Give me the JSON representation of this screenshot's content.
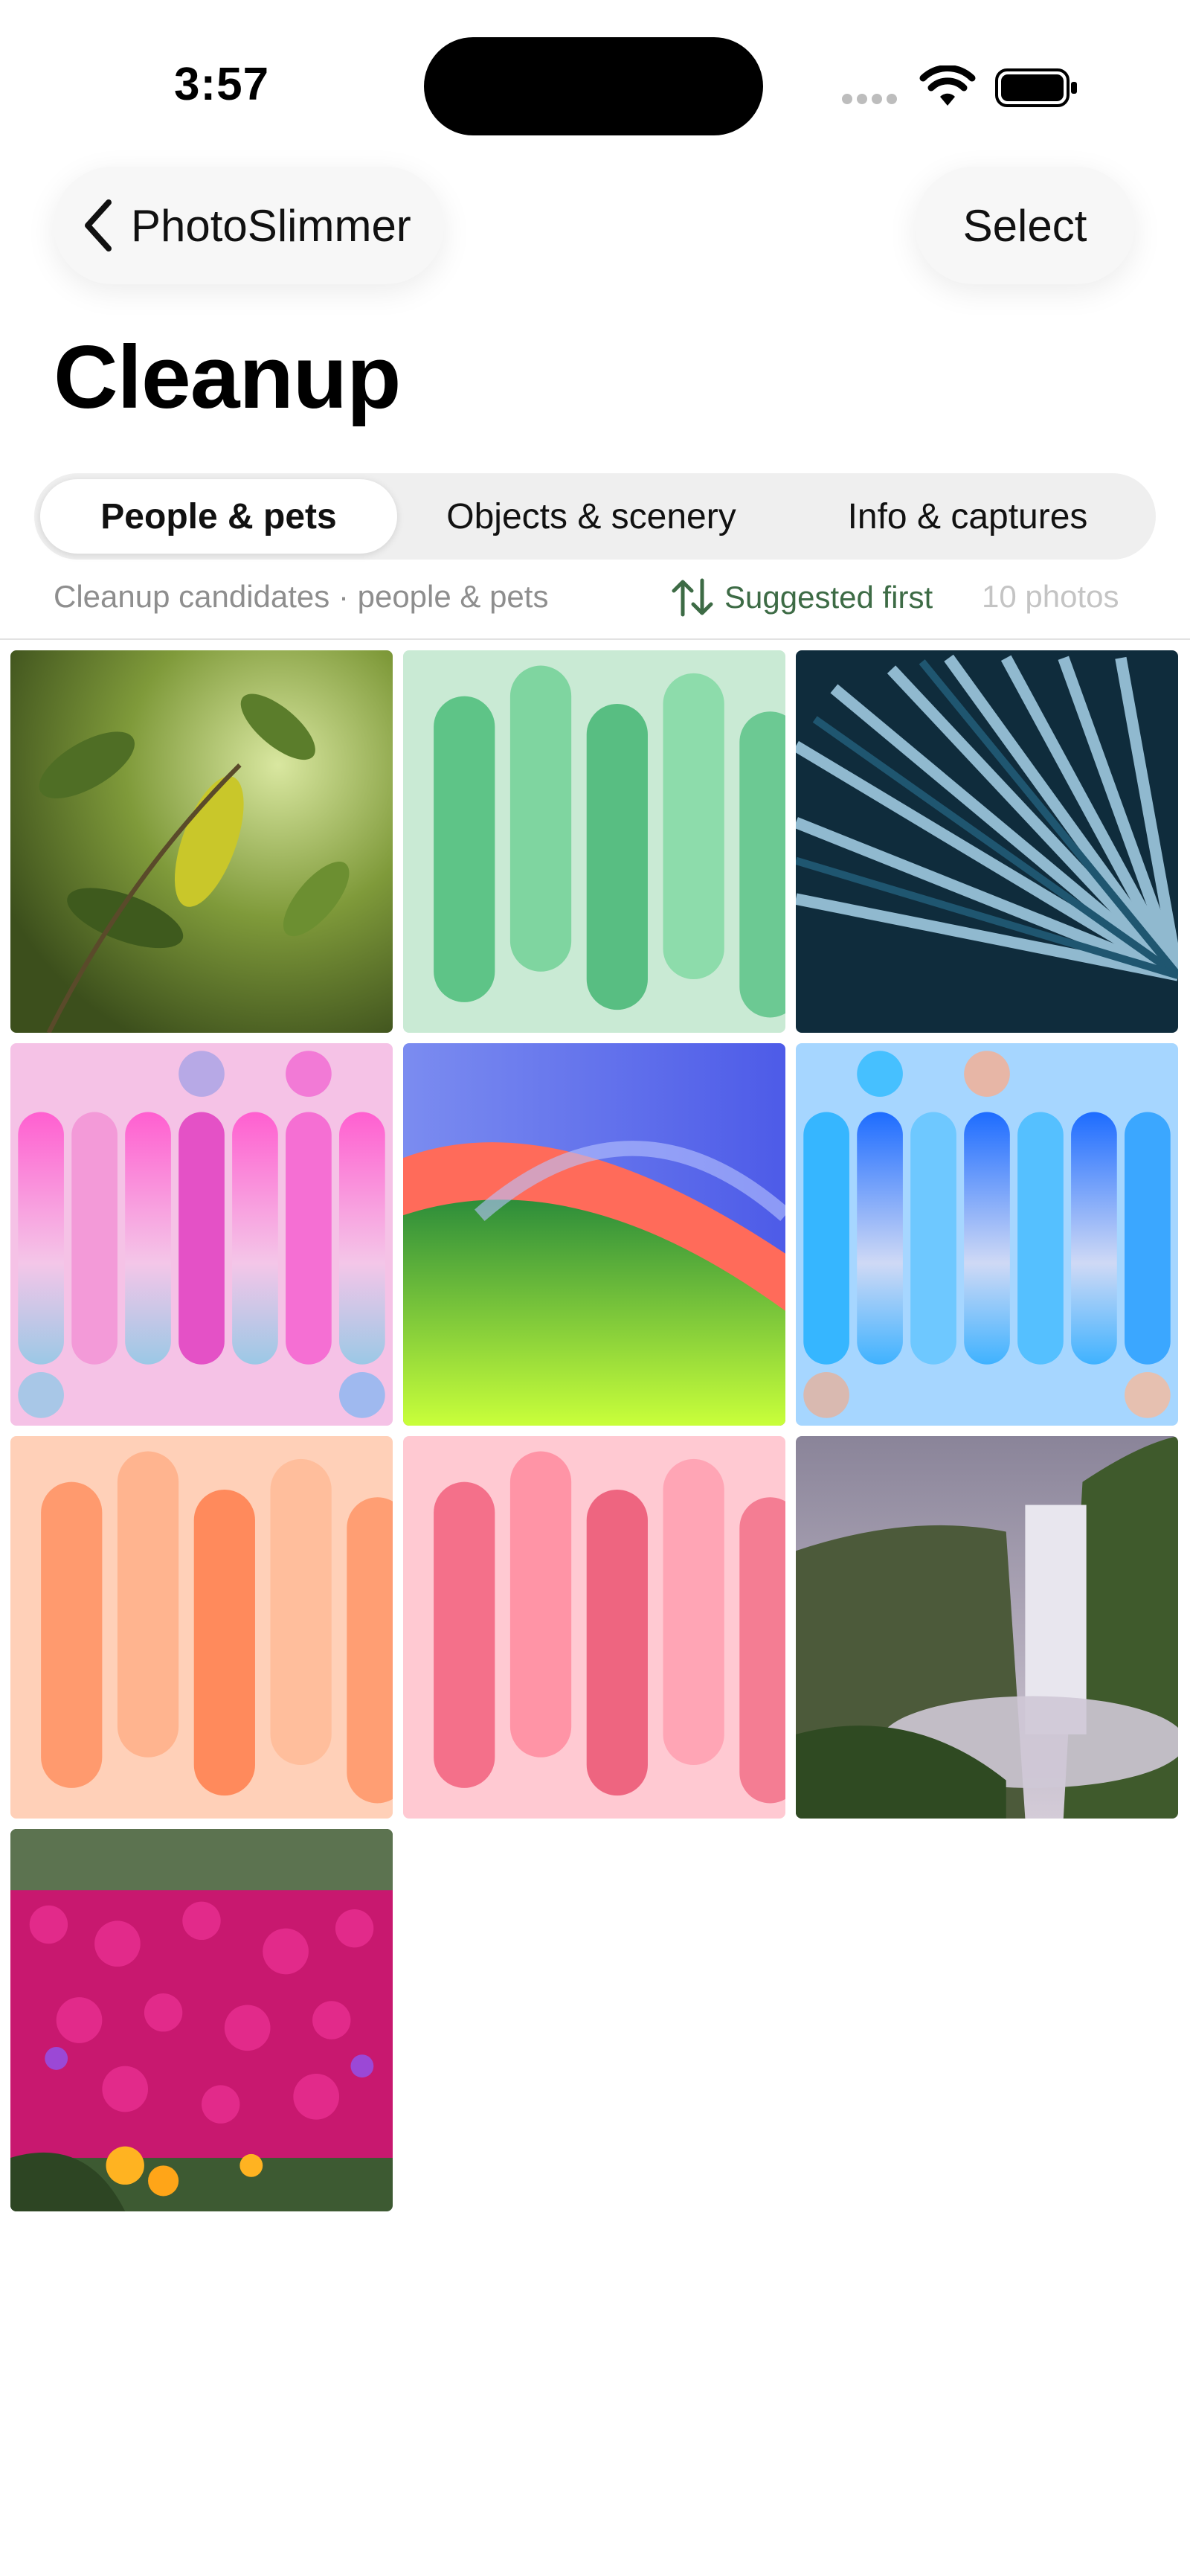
{
  "status_bar": {
    "time": "3:57"
  },
  "nav": {
    "back_label": "PhotoSlimmer",
    "select_label": "Select"
  },
  "title": "Cleanup",
  "tabs": [
    {
      "label": "People & pets",
      "active": true
    },
    {
      "label": "Objects & scenery",
      "active": false
    },
    {
      "label": "Info & captures",
      "active": false
    }
  ],
  "subheader": {
    "description": "Cleanup candidates · people & pets",
    "sort_label": "Suggested first",
    "count": "10 photos"
  },
  "colors": {
    "accent_green": "#3d6b45",
    "muted_text": "#8e8e8e"
  },
  "photos": [
    {
      "subject": "leafy-plant"
    },
    {
      "subject": "green-abstract-shapes"
    },
    {
      "subject": "blue-fan-abstract"
    },
    {
      "subject": "pink-capsule-pattern"
    },
    {
      "subject": "sonoma-hills"
    },
    {
      "subject": "blue-capsule-pattern"
    },
    {
      "subject": "orange-abstract-shapes"
    },
    {
      "subject": "pink-abstract-shapes"
    },
    {
      "subject": "waterfall-cliff"
    },
    {
      "subject": "magenta-flower-field"
    }
  ]
}
